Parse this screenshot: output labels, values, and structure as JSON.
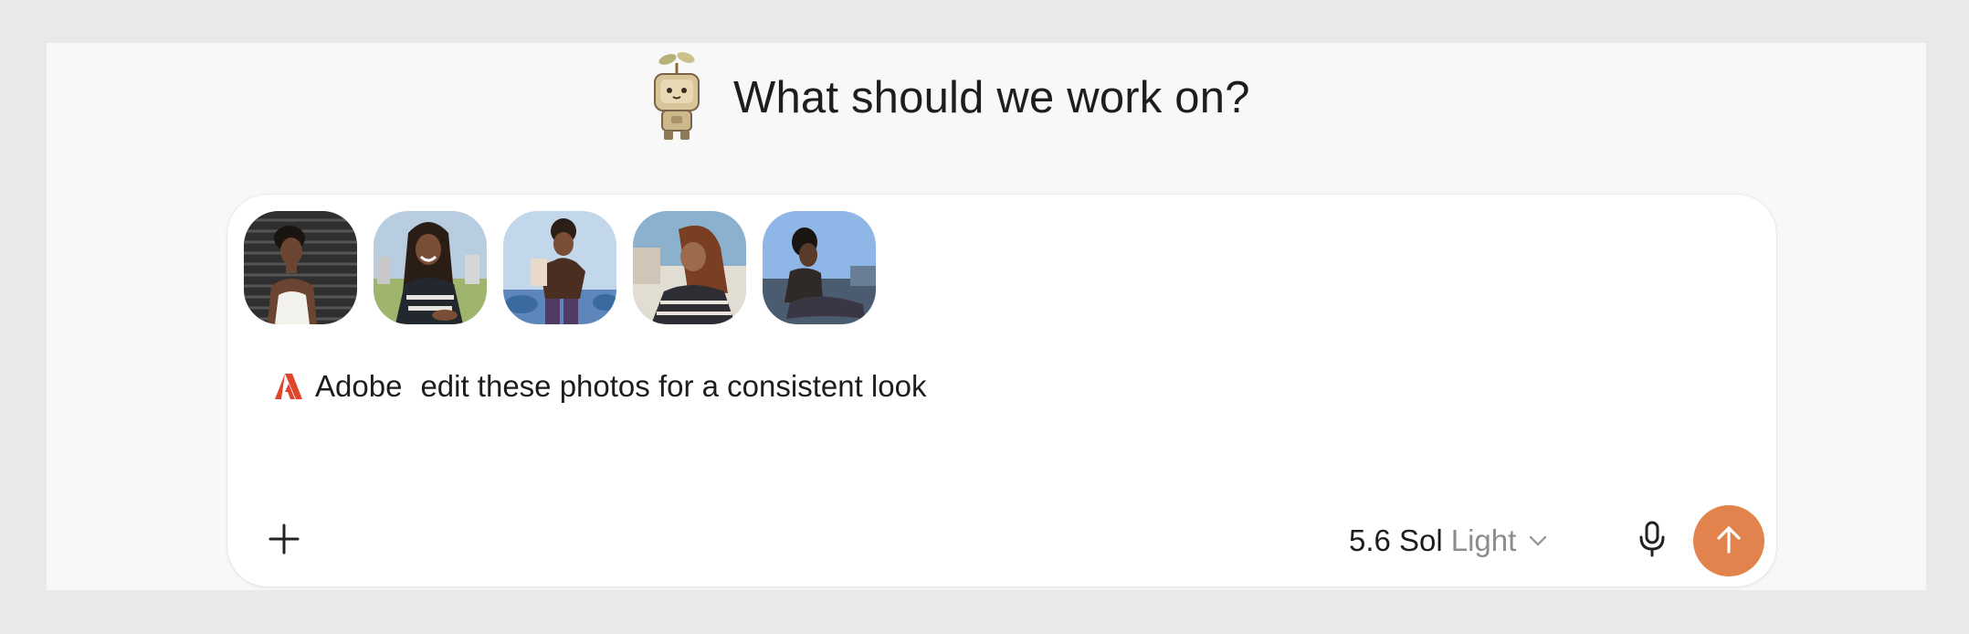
{
  "header": {
    "title": "What should we work on?",
    "mascot_icon": "sprout-robot-mascot"
  },
  "composer": {
    "attachments": [
      {
        "name": "photo-1",
        "icon": "photo-thumbnail"
      },
      {
        "name": "photo-2",
        "icon": "photo-thumbnail"
      },
      {
        "name": "photo-3",
        "icon": "photo-thumbnail"
      },
      {
        "name": "photo-4",
        "icon": "photo-thumbnail"
      },
      {
        "name": "photo-5",
        "icon": "photo-thumbnail"
      }
    ],
    "app_mention": {
      "label": "Adobe",
      "icon": "adobe-logo-icon",
      "color": "#e0452c"
    },
    "prompt_text": "edit these photos for a consistent look",
    "toolbar": {
      "add_icon": "plus-icon",
      "model_name": "5.6 Sol",
      "model_variant": "Light",
      "model_chevron_icon": "chevron-down-icon",
      "mic_icon": "microphone-icon",
      "send_icon": "arrow-up-icon",
      "send_color": "#e2834d"
    }
  }
}
